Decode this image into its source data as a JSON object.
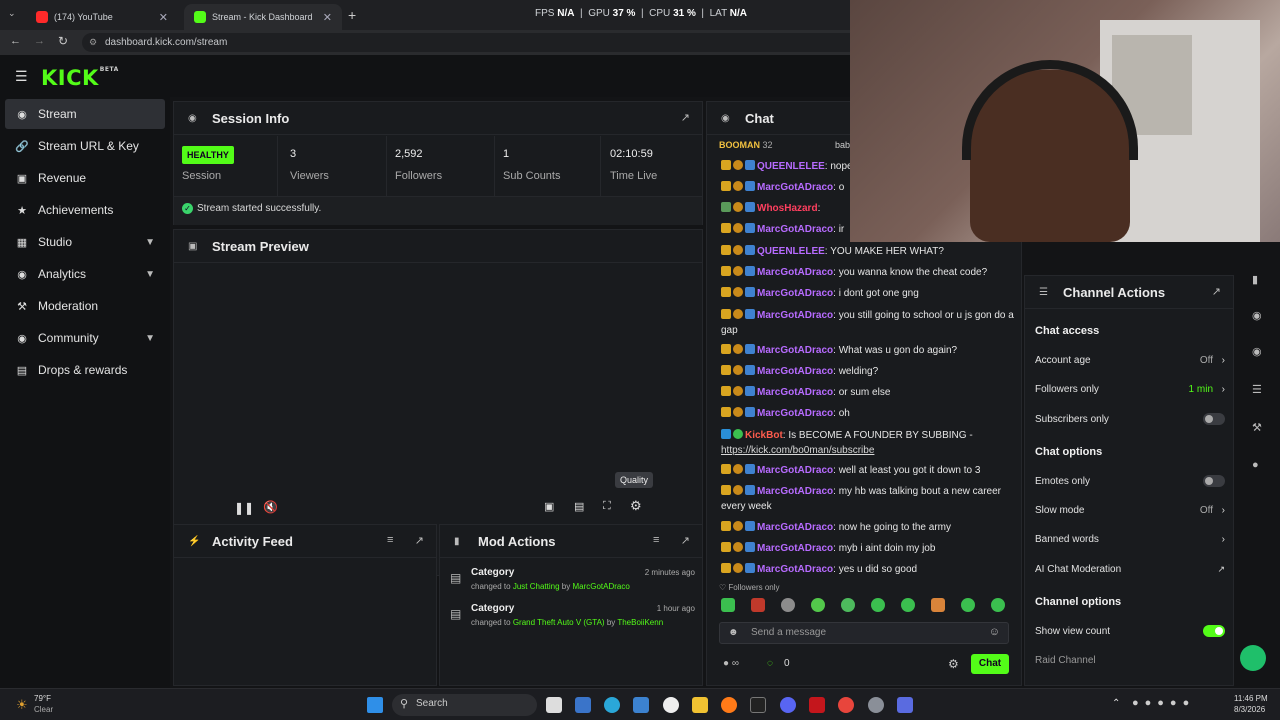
{
  "browser": {
    "tabs": [
      {
        "title": "(174) YouTube"
      },
      {
        "title": "Stream - Kick Dashboard"
      }
    ],
    "new_tab": "+",
    "url": "dashboard.kick.com/stream",
    "perf": {
      "fps_label": "FPS",
      "fps": "N/A",
      "gpu_label": "GPU",
      "gpu": "37 %",
      "cpu_label": "CPU",
      "cpu": "31 %",
      "lat_label": "LAT",
      "lat": "N/A"
    }
  },
  "app": {
    "logo": "KICK",
    "logo_tag": "BETA"
  },
  "sidebar": {
    "items": [
      {
        "label": "Stream",
        "icon": "broadcast-icon"
      },
      {
        "label": "Stream URL & Key",
        "icon": "link-icon"
      },
      {
        "label": "Revenue",
        "icon": "revenue-icon"
      },
      {
        "label": "Achievements",
        "icon": "trophy-icon"
      },
      {
        "label": "Studio",
        "icon": "studio-icon"
      },
      {
        "label": "Analytics",
        "icon": "analytics-icon"
      },
      {
        "label": "Moderation",
        "icon": "hammer-icon"
      },
      {
        "label": "Community",
        "icon": "community-icon"
      },
      {
        "label": "Drops & rewards",
        "icon": "gift-icon"
      }
    ]
  },
  "session": {
    "title": "Session Info",
    "health": "HEALTHY",
    "stats": [
      {
        "value": "",
        "label": "Session"
      },
      {
        "value": "3",
        "label": "Viewers"
      },
      {
        "value": "2,592",
        "label": "Followers"
      },
      {
        "value": "1",
        "label": "Sub Counts"
      },
      {
        "value": "02:10:59",
        "label": "Time Live"
      }
    ],
    "status": "Stream started successfully."
  },
  "preview": {
    "title": "Stream Preview",
    "tooltip": "Quality"
  },
  "activity": {
    "title": "Activity Feed"
  },
  "mod_actions": {
    "title": "Mod Actions",
    "entries": [
      {
        "type": "Category",
        "time": "2 minutes ago",
        "pre": "changed to",
        "value": "Just Chatting",
        "by": "by",
        "user": "MarcGotADraco"
      },
      {
        "type": "Category",
        "time": "1 hour ago",
        "pre": "changed to",
        "value": "Grand Theft Auto V (GTA)",
        "by": "by",
        "user": "TheBoiiKenn"
      }
    ]
  },
  "chat": {
    "title": "Chat",
    "pinned_user": "BOOMAN",
    "pinned_count": "32",
    "pinned_right": "baby",
    "messages": [
      {
        "user": "QUEENLELEE",
        "text": "nope",
        "color": "purple"
      },
      {
        "user": "MarcGotADraco",
        "text": "o",
        "color": "purple"
      },
      {
        "user": "WhosHazard",
        "text": "",
        "color": "red"
      },
      {
        "user": "MarcGotADraco",
        "text": "ir",
        "color": "purple"
      },
      {
        "user": "QUEENLELEE",
        "text": "YOU MAKE HER WHAT?",
        "color": "purple"
      },
      {
        "user": "MarcGotADraco",
        "text": "you wanna know the cheat code?",
        "color": "purple"
      },
      {
        "user": "MarcGotADraco",
        "text": "i dont got one gng",
        "color": "purple"
      },
      {
        "user": "MarcGotADraco",
        "text": "you still going to school or u js gon do a gap",
        "color": "purple"
      },
      {
        "user": "MarcGotADraco",
        "text": "What was u gon do again?",
        "color": "purple"
      },
      {
        "user": "MarcGotADraco",
        "text": "welding?",
        "color": "purple"
      },
      {
        "user": "MarcGotADraco",
        "text": "or sum else",
        "color": "purple"
      },
      {
        "user": "MarcGotADraco",
        "text": "oh",
        "color": "purple"
      },
      {
        "user": "KickBot",
        "text": "Is BECOME A FOUNDER BY SUBBING -",
        "link": "https://kick.com/bo0man/subscribe",
        "color": "bot"
      },
      {
        "user": "MarcGotADraco",
        "text": "well at least you got it down to 3",
        "color": "purple"
      },
      {
        "user": "MarcGotADraco",
        "text": "my hb was talking bout a new career every week",
        "color": "purple"
      },
      {
        "user": "MarcGotADraco",
        "text": "now he going to the army",
        "color": "purple"
      },
      {
        "user": "MarcGotADraco",
        "text": "myb i aint doin my job",
        "color": "purple"
      },
      {
        "user": "MarcGotADraco",
        "text": "yes u did so good",
        "color": "purple"
      }
    ],
    "followers_only": "Followers only",
    "placeholder": "Send a message",
    "points": "0",
    "send_label": "Chat"
  },
  "channel_actions": {
    "title": "Channel Actions",
    "chat_access": "Chat access",
    "account_age": {
      "label": "Account age",
      "value": "Off"
    },
    "followers_only": {
      "label": "Followers only",
      "value": "1 min"
    },
    "subscribers_only": {
      "label": "Subscribers only",
      "on": false
    },
    "chat_options": "Chat options",
    "emotes_only": {
      "label": "Emotes only",
      "on": false
    },
    "slow_mode": {
      "label": "Slow mode",
      "value": "Off"
    },
    "banned_words": {
      "label": "Banned words"
    },
    "ai_mod": {
      "label": "AI Chat Moderation"
    },
    "channel_options": "Channel options",
    "show_view_count": {
      "label": "Show view count",
      "on": true
    },
    "raid": {
      "label": "Raid Channel"
    }
  },
  "taskbar": {
    "temp": "79°F",
    "weather": "Clear",
    "search": "Search",
    "time": "11:46 PM",
    "date": "8/3/2026"
  },
  "colors": {
    "accent": "#53fc18",
    "purple_user": "#b76bff",
    "red_user": "#ff3f5f"
  }
}
